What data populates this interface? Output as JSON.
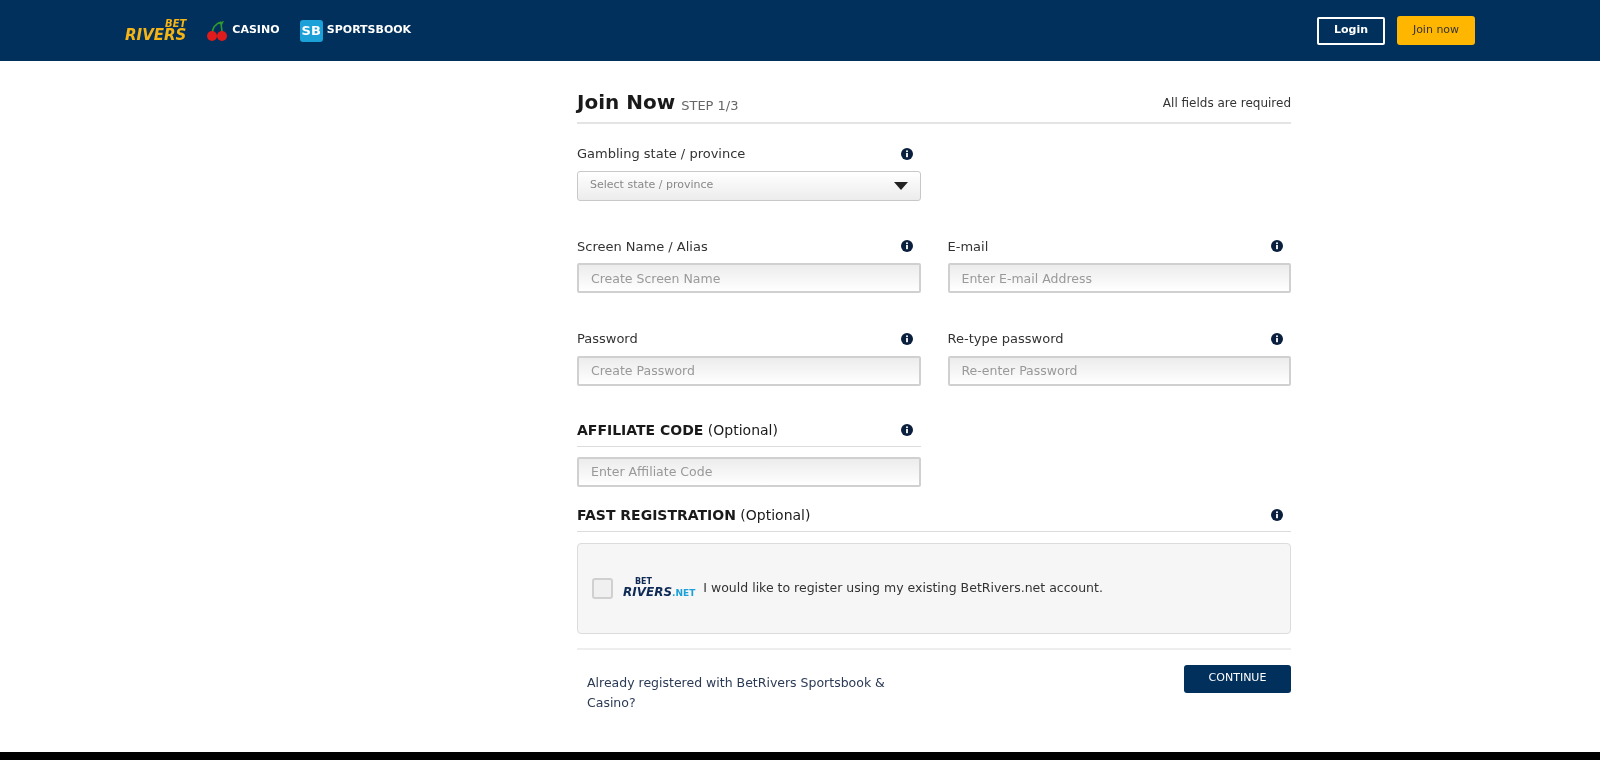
{
  "header": {
    "brand": {
      "top": "BET",
      "bottom": "RIVERS"
    },
    "links": [
      {
        "kind": "casino",
        "label": "CASINO"
      },
      {
        "kind": "sportsbook",
        "badge": "SB",
        "label": "SPORTSBOOK"
      }
    ],
    "login": "Login",
    "join": "Join now"
  },
  "form": {
    "title": "Join Now",
    "step": "STEP 1/3",
    "note": "All fields are required",
    "rows": [
      [
        {
          "kind": "select",
          "label": "Gambling state / province",
          "placeholder": "Select state / province"
        }
      ],
      [
        {
          "kind": "input",
          "label": "Screen Name / Alias",
          "placeholder": "Create Screen Name"
        },
        {
          "kind": "input",
          "label": "E-mail",
          "placeholder": "Enter E-mail Address"
        }
      ],
      [
        {
          "kind": "input",
          "label": "Password",
          "placeholder": "Create Password"
        },
        {
          "kind": "input",
          "label": "Re-type password",
          "placeholder": "Re-enter Password"
        }
      ]
    ],
    "affiliate": {
      "heading": "AFFILIATE CODE",
      "optional": "(Optional)",
      "placeholder": "Enter Affiliate Code"
    },
    "fast": {
      "heading": "FAST REGISTRATION",
      "optional": "(Optional)",
      "checked": false,
      "logo": {
        "top": "BET",
        "bottom": "RIVERS",
        "suffix": ".NET"
      },
      "text": "I would like to register using my existing BetRivers.net account."
    },
    "footer_text": "Already registered with BetRivers Sportsbook & Casino?",
    "continue": "CONTINUE"
  }
}
